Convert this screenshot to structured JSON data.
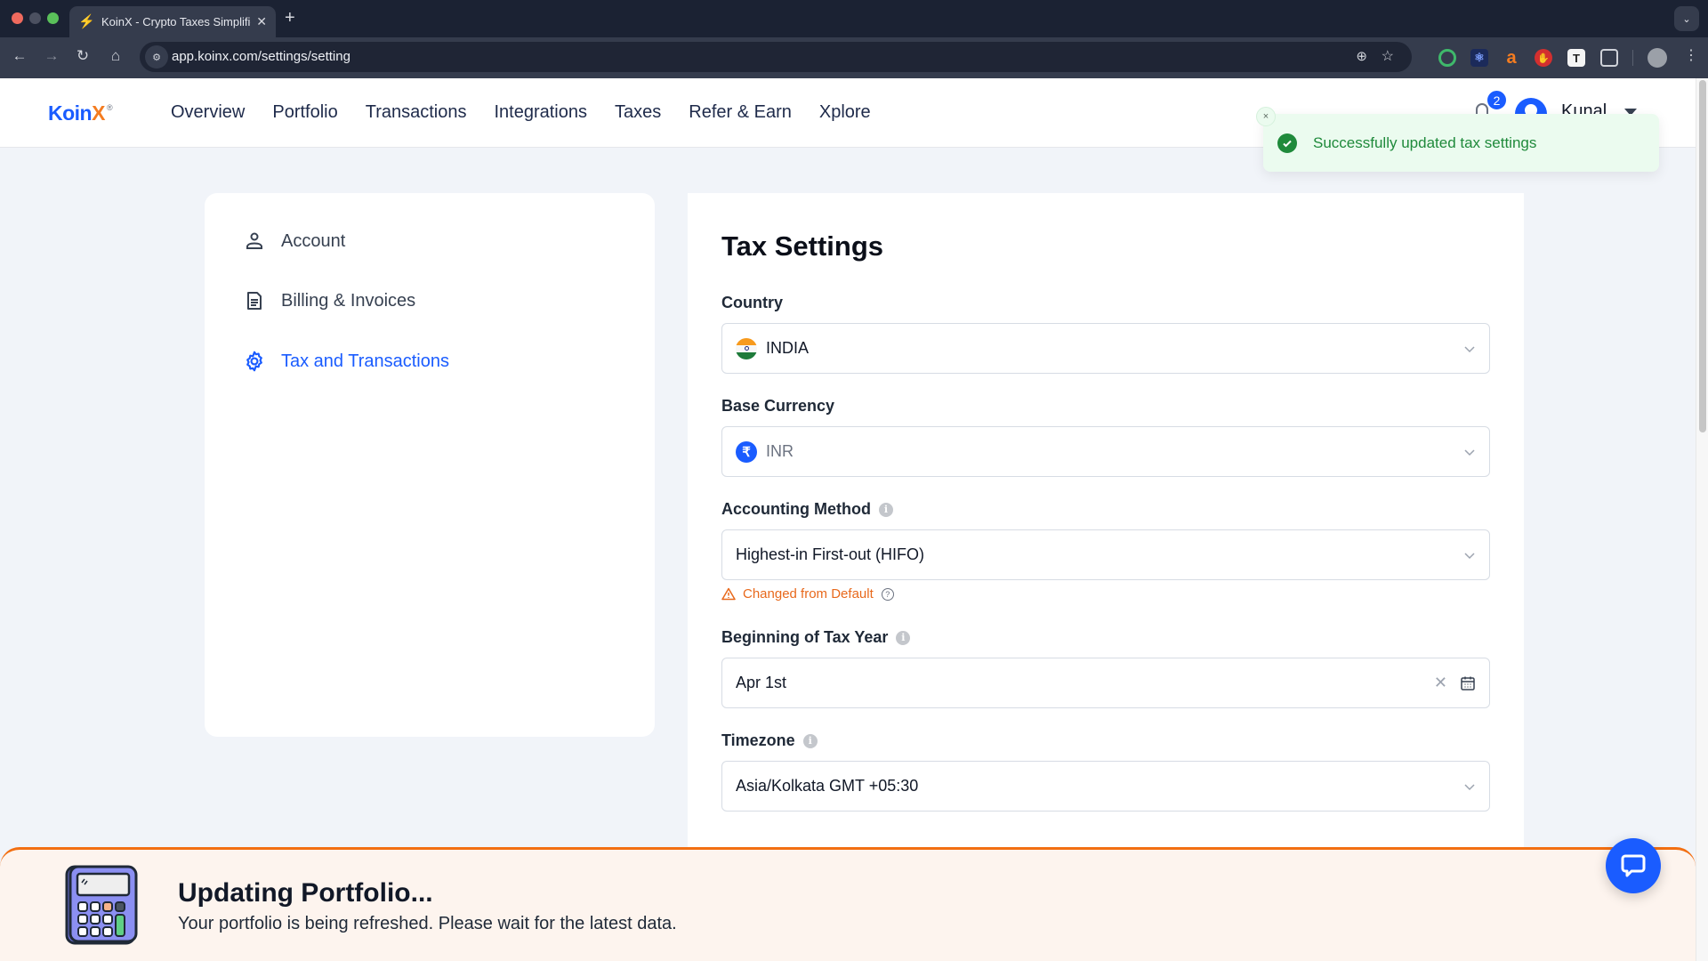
{
  "browser": {
    "tab_title": "KoinX - Crypto Taxes Simplified",
    "tab_favicon": "koinx-favicon",
    "new_tab_label": "+",
    "url": "app.koinx.com/settings/setting",
    "extensions": [
      "target-extension",
      "react-devtools-extension",
      "amazon-assistant-extension",
      "adblock-extension",
      "text-extension",
      "puzzle-extensions-icon"
    ]
  },
  "header": {
    "logo_main": "Koin",
    "logo_accent": "X",
    "logo_mark": "®",
    "nav": [
      "Overview",
      "Portfolio",
      "Transactions",
      "Integrations",
      "Taxes",
      "Refer & Earn",
      "Xplore"
    ],
    "notification_count": "2",
    "user_name": "Kunal"
  },
  "toast": {
    "message": "Successfully updated tax settings",
    "close": "×",
    "color": "#1f8a3b"
  },
  "sidebar": {
    "items": [
      {
        "label": "Account",
        "icon": "user-icon",
        "active": false
      },
      {
        "label": "Billing & Invoices",
        "icon": "document-icon",
        "active": false
      },
      {
        "label": "Tax and Transactions",
        "icon": "gear-icon",
        "active": true
      }
    ]
  },
  "settings": {
    "title": "Tax Settings",
    "country": {
      "label": "Country",
      "value": "INDIA"
    },
    "base_currency": {
      "label": "Base Currency",
      "value": "INR",
      "symbol": "₹"
    },
    "accounting_method": {
      "label": "Accounting Method",
      "value": "Highest-in First-out (HIFO)",
      "warning": "Changed from Default"
    },
    "tax_year_start": {
      "label": "Beginning of Tax Year",
      "value": "Apr 1st"
    },
    "timezone": {
      "label": "Timezone",
      "value": "Asia/Kolkata GMT +05:30"
    },
    "info_glyph": "i",
    "help_glyph": "?"
  },
  "banner": {
    "title": "Updating Portfolio...",
    "subtitle": "Your portfolio is being refreshed. Please wait for the latest data."
  },
  "colors": {
    "brand_blue": "#1a5cff",
    "brand_orange": "#f47c20",
    "warning_orange": "#e8691c",
    "success_green": "#1f8a3b"
  }
}
